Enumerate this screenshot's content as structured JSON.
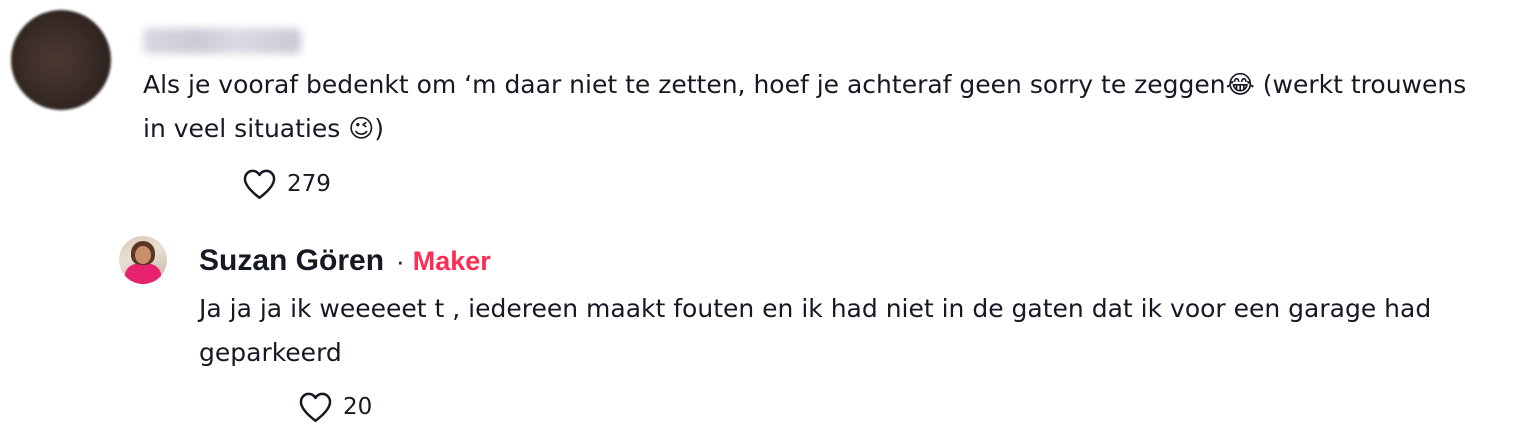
{
  "comment": {
    "text": "Als je vooraf bedenkt om ‘m daar niet te zetten, hoef je achteraf geen sorry te zeggen😂 (werkt trouwens in veel situaties 😉)",
    "likes": "279",
    "icons": {
      "avatar": "blurred-avatar",
      "like": "heart-icon"
    }
  },
  "reply": {
    "author": "Suzan Gören",
    "separator": "·",
    "badge": "Maker",
    "text": "Ja ja ja ik weeeeet t , iedereen maakt fouten en ik had niet in de gaten dat ik voor een garage had geparkeerd",
    "likes": "20",
    "icons": {
      "like": "heart-icon"
    }
  },
  "colors": {
    "text": "#161823",
    "badge": "#fe2c55",
    "background": "#ffffff"
  }
}
